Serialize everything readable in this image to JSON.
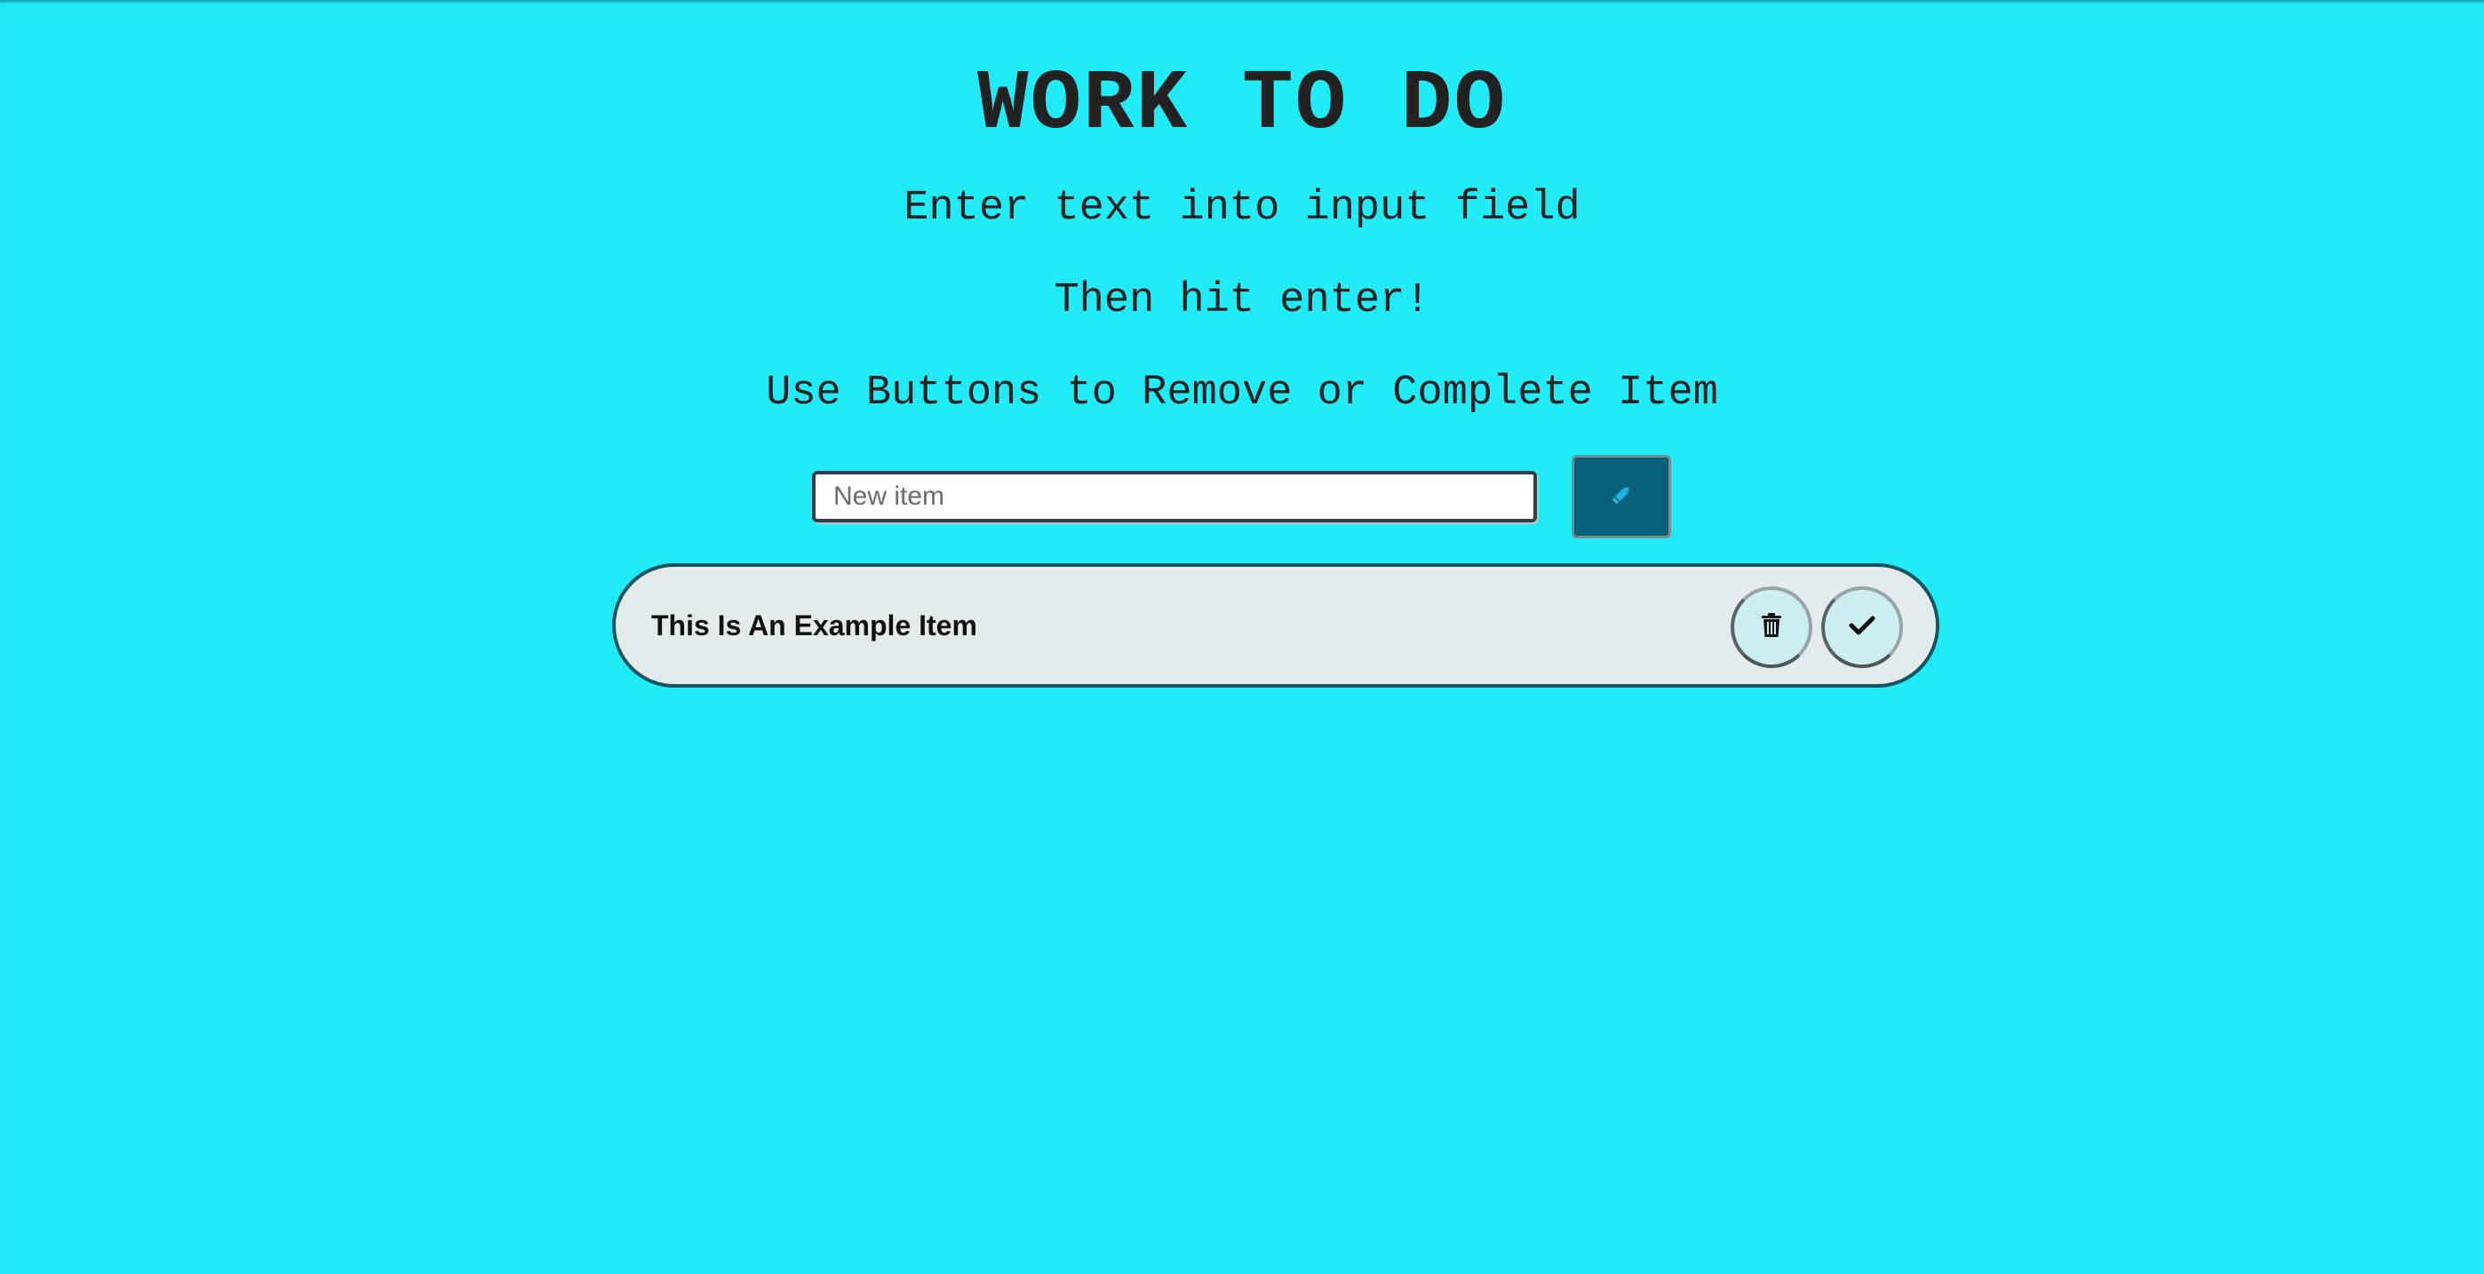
{
  "header": {
    "title": "WORK TO DO",
    "instruction_1": "Enter text into input field",
    "instruction_2": "Then hit enter!",
    "instruction_3": "Use Buttons to Remove or Complete Item"
  },
  "form": {
    "input_placeholder": "New item",
    "input_value": "",
    "add_button_icon": "pencil-icon"
  },
  "todo_list": {
    "items": [
      {
        "text": "This Is An Example Item",
        "remove_icon": "trash-icon",
        "complete_icon": "checkmark-icon"
      }
    ]
  },
  "colors": {
    "background": "#21ebf7",
    "add_button": "#06607a",
    "pencil": "#19b9dd",
    "item_background": "#e4ebec",
    "item_border": "#14555f",
    "circle_button": "#cbeff0"
  }
}
